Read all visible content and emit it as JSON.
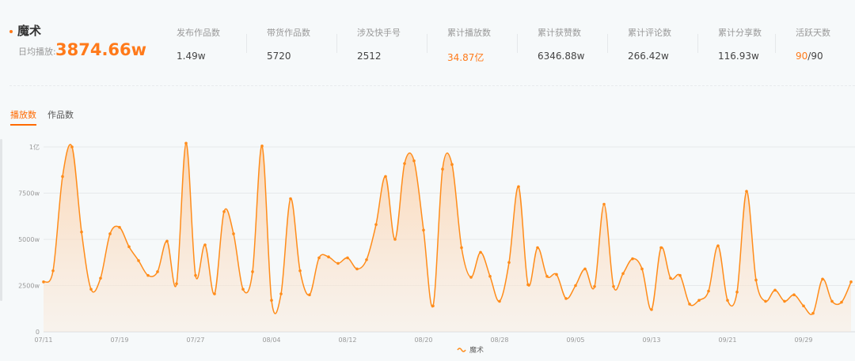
{
  "header": {
    "category": "魔术",
    "avg_label": "日均播放:",
    "avg_value": "3874.66w"
  },
  "stats": [
    {
      "label": "发布作品数",
      "value": "1.49w"
    },
    {
      "label": "带货作品数",
      "value": "5720"
    },
    {
      "label": "涉及快手号",
      "value": "2512"
    },
    {
      "label": "累计播放数",
      "value": "34.87亿",
      "highlight": true
    },
    {
      "label": "累计获赞数",
      "value": "6346.88w"
    },
    {
      "label": "累计评论数",
      "value": "266.42w"
    },
    {
      "label": "累计分享数",
      "value": "116.93w"
    },
    {
      "label": "活跃天数",
      "value_highlight": "90",
      "value_rest": "/90"
    }
  ],
  "tabs": [
    {
      "label": "播放数",
      "active": true
    },
    {
      "label": "作品数",
      "active": false
    }
  ],
  "colors": {
    "accent": "#ff7a1a",
    "line": "#ff8c1a"
  },
  "chart_data": {
    "type": "area",
    "title": "",
    "xlabel": "",
    "ylabel": "",
    "start_date": "07/11",
    "x_tick_labels": [
      "07/11",
      "07/19",
      "07/27",
      "08/04",
      "08/12",
      "08/20",
      "08/28",
      "09/05",
      "09/13",
      "09/21",
      "09/29"
    ],
    "x_tick_every_days": 8,
    "y_tick_labels": [
      "0",
      "2500w",
      "5000w",
      "7500w",
      "1亿"
    ],
    "ylim": [
      0,
      10000
    ],
    "unit": "w",
    "grid": true,
    "legend": {
      "position": "bottom",
      "entries": [
        "魔术"
      ]
    },
    "series": [
      {
        "name": "魔术",
        "values": [
          2700,
          3300,
          8400,
          10000,
          5400,
          2300,
          2900,
          5300,
          5650,
          4600,
          3850,
          3050,
          3250,
          4900,
          2600,
          10200,
          3050,
          4700,
          2050,
          6500,
          5300,
          2300,
          3250,
          10050,
          1700,
          2050,
          7200,
          3300,
          2000,
          4000,
          4050,
          3700,
          4000,
          3400,
          3900,
          5800,
          8400,
          5000,
          9100,
          9250,
          5500,
          1400,
          8800,
          9050,
          4550,
          2950,
          4300,
          3000,
          1650,
          3750,
          7850,
          2550,
          4550,
          3000,
          3100,
          1800,
          2500,
          3400,
          2450,
          6900,
          2450,
          3150,
          3950,
          3400,
          1200,
          4550,
          2900,
          3050,
          1500,
          1700,
          2200,
          4650,
          1700,
          2150,
          7600,
          2800,
          1650,
          2250,
          1650,
          2000,
          1400,
          1000,
          2850,
          1650,
          1600,
          2700
        ]
      }
    ]
  }
}
